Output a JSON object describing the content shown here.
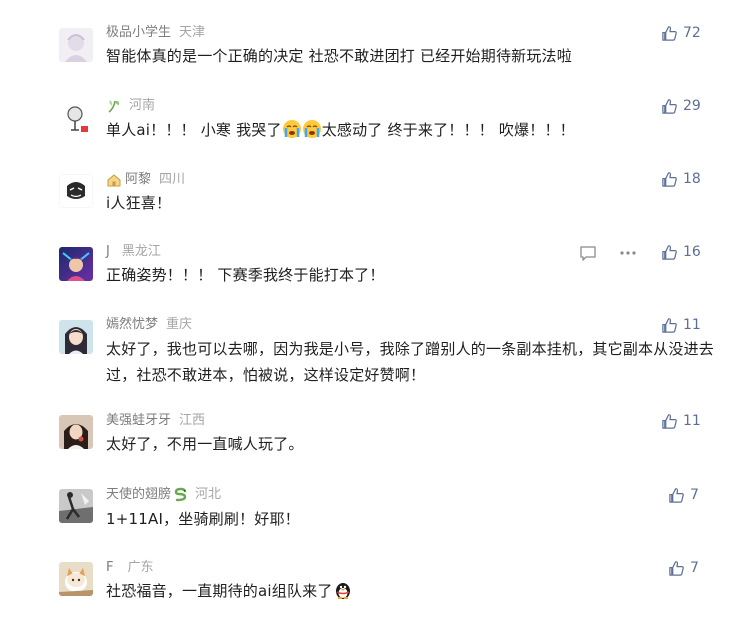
{
  "comments": [
    {
      "name": "极品小学生",
      "location": "天津",
      "text": "智能体真的是一个正确的决定 社恐不敢进团打 已经开始期待新玩法啦",
      "likes": "72"
    },
    {
      "name": "",
      "location": "河南",
      "text_a": "单人ai！！！ 小寒 我哭了",
      "text_b": "太感动了 终于来了！！！ 吹爆！！！",
      "likes": "29"
    },
    {
      "name": "阿黎",
      "location": "四川",
      "text": "i人狂喜！",
      "likes": "18"
    },
    {
      "name": "J",
      "location": "黑龙江",
      "text": "正确姿势！！！ 下赛季我终于能打本了！",
      "likes": "16"
    },
    {
      "name": "嫣然忧梦",
      "location": "重庆",
      "text": "太好了，我也可以去哪，因为我是小号，我除了蹭别人的一条副本挂机，其它副本从没进去过，社恐不敢进本，怕被说，这样设定好赞啊！",
      "likes": "11"
    },
    {
      "name": "美强蛙牙牙",
      "location": "江西",
      "text": "太好了，不用一直喊人玩了。",
      "likes": "11"
    },
    {
      "name": "天使的翅膀",
      "location": "河北",
      "text": "1+11AI，坐骑刷刷！好耶！",
      "likes": "7"
    },
    {
      "name": "F",
      "location": "广东",
      "text": "社恐福音，一直期待的ai组队来了",
      "likes": "7"
    }
  ],
  "icons": {
    "like": "thumbs-up-icon",
    "comment": "comment-bubble-icon",
    "more": "more-dots-icon",
    "cry": "crying-face-emoji",
    "penguin": "penguin-emoji"
  },
  "colors": {
    "like_accent": "#5d6f95",
    "meta_text": "#8a8a8a",
    "body_text": "#1f1f1f"
  }
}
